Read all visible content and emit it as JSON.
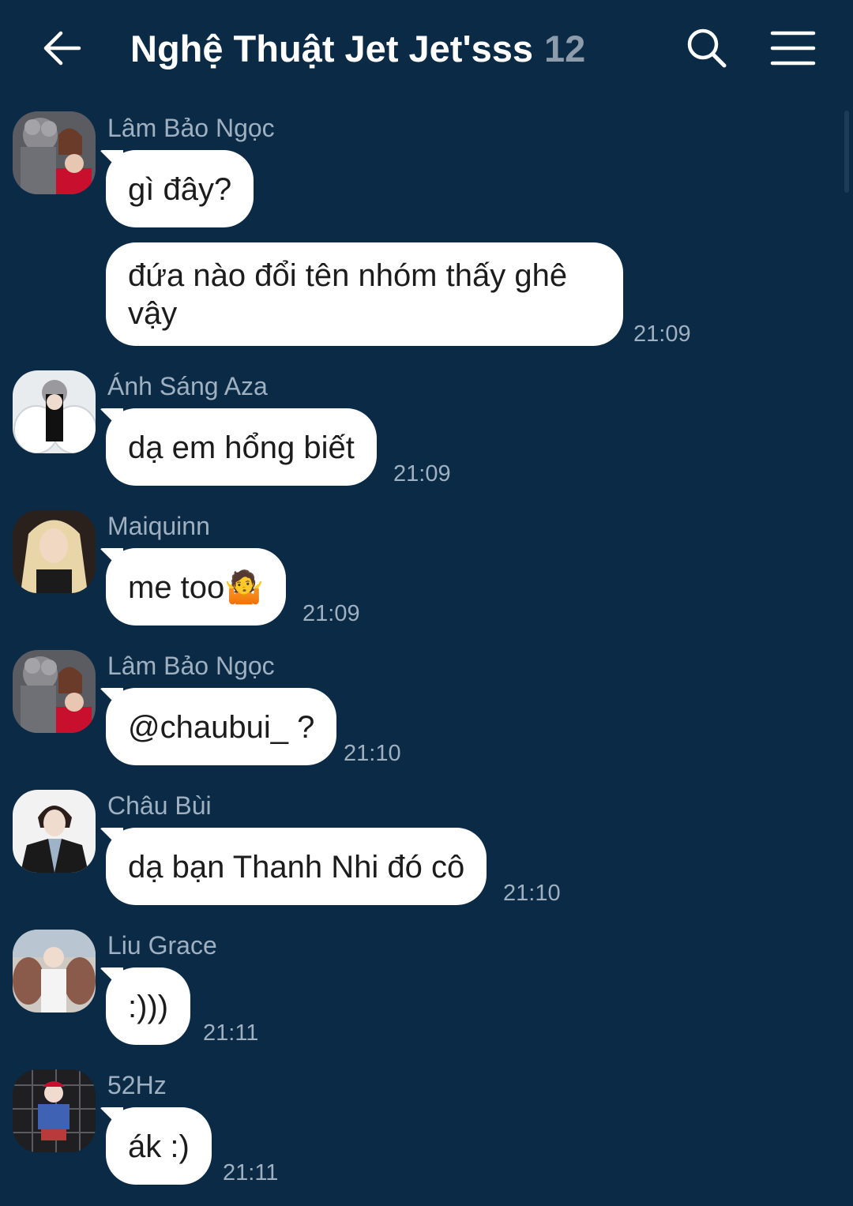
{
  "header": {
    "title": "Nghệ Thuật Jet Jet'sss",
    "member_count": "12",
    "back_icon": "arrow-left-icon",
    "search_icon": "search-icon",
    "menu_icon": "hamburger-menu-icon"
  },
  "colors": {
    "background": "#0b2a45",
    "bubble": "#ffffff",
    "muted_text": "#9fb0c1"
  },
  "messages": [
    {
      "sender": "Lâm Bảo Ngọc",
      "text": "gì đây?",
      "time": ""
    },
    {
      "sender": "",
      "text": "đứa nào đổi tên nhóm thấy ghê vậy",
      "time": "21:09"
    },
    {
      "sender": "Ánh Sáng Aza",
      "text": "dạ em hổng biết",
      "time": "21:09"
    },
    {
      "sender": "Maiquinn",
      "text": "me too",
      "emoji": "🤷",
      "time": "21:09"
    },
    {
      "sender": "Lâm Bảo Ngọc",
      "text": "@chaubui_ ?",
      "time": "21:10"
    },
    {
      "sender": "Châu Bùi",
      "text": "dạ bạn Thanh Nhi đó cô",
      "time": "21:10"
    },
    {
      "sender": "Liu Grace",
      "text": ":)))",
      "time": "21:11"
    },
    {
      "sender": "52Hz",
      "text": "ák :)",
      "time": "21:11"
    }
  ]
}
